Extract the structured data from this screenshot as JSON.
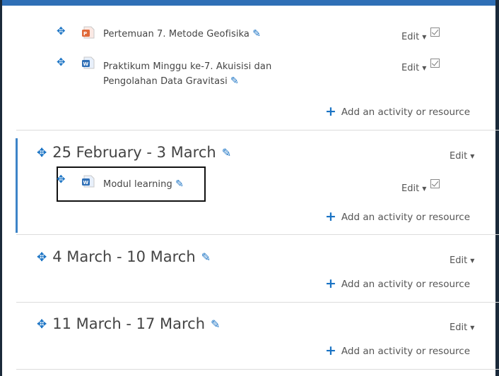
{
  "top_section": {
    "activities": [
      {
        "name": "Pertemuan 7. Metode Geofisika",
        "icon": "powerpoint-icon",
        "edit_label": "Edit"
      },
      {
        "name_line1": "Praktikum Minggu ke-7. Akuisisi dan",
        "name_line2": "Pengolahan Data Gravitasi",
        "icon": "word-icon",
        "edit_label": "Edit"
      }
    ],
    "add_label": "Add an activity or resource"
  },
  "sections": [
    {
      "title": "25 February - 3 March",
      "edit_label": "Edit",
      "current": true,
      "activities": [
        {
          "name": "Modul learning",
          "icon": "word-icon",
          "edit_label": "Edit"
        }
      ],
      "add_label": "Add an activity or resource"
    },
    {
      "title": "4 March - 10 March",
      "edit_label": "Edit",
      "add_label": "Add an activity or resource"
    },
    {
      "title": "11 March - 17 March",
      "edit_label": "Edit",
      "add_label": "Add an activity or resource"
    }
  ],
  "colors": {
    "accent": "#1a73c4",
    "current_bar": "#3d84c8",
    "header_bar": "#2f6fb6"
  }
}
